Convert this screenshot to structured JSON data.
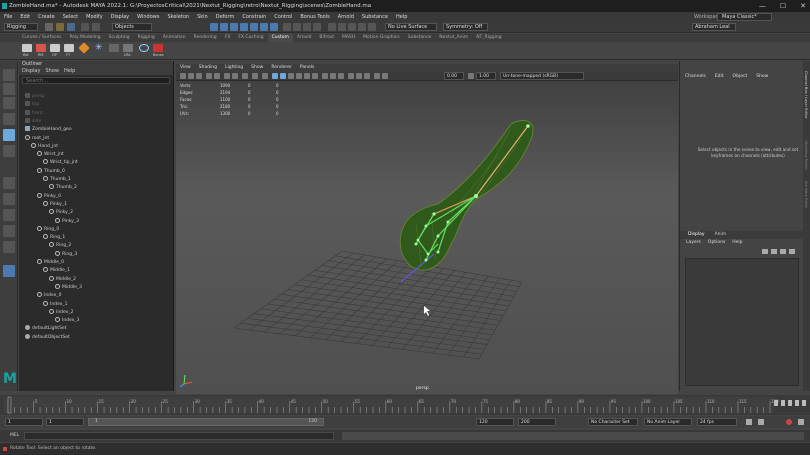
{
  "window": {
    "title": "ZombieHand.ma* - Autodesk MAYA 2022.1: G:\\ProyectosCritical\\2021\\Nextut_Rigging\\retro\\Nextut_Rigging\\scenes\\ZombieHand.ma",
    "minimize": "—",
    "maximize": "☐",
    "close": "✕"
  },
  "menubar": [
    "File",
    "Edit",
    "Create",
    "Select",
    "Modify",
    "Display",
    "Windows",
    "Skeleton",
    "Skin",
    "Deform",
    "Constrain",
    "Control",
    "Bonus Tools",
    "Arnold",
    "Substance",
    "Help"
  ],
  "workspace": {
    "label": "Workspace :",
    "value": "Maya Classic*"
  },
  "statusline": {
    "mode": "Rigging",
    "objects": "Objects",
    "live_surface": "No Live Surface",
    "symmetry": "Symmetry: Off",
    "user": "Abraham Leal"
  },
  "shelf_tabs": [
    "Curves / Surfaces",
    "Poly Modeling",
    "Sculpting",
    "Rigging",
    "Animation",
    "Rendering",
    "FX",
    "FX Caching",
    "Custom",
    "Arnold",
    "Bifrost",
    "MASH",
    "Motion Graphics",
    "Substance",
    "Nextut_Anim",
    "NT_Rigging"
  ],
  "shelf_tabs_active": "Custom",
  "shelf_items": [
    "Rot",
    "RM",
    "OP",
    "FT",
    "",
    "",
    "",
    "LRA",
    "",
    "Bones"
  ],
  "outliner": {
    "title": "Outliner",
    "menus": [
      "Display",
      "Show",
      "Help"
    ],
    "search_placeholder": "Search...",
    "items": [
      {
        "label": "persp",
        "depth": 0,
        "kind": "cam",
        "dim": true
      },
      {
        "label": "top",
        "depth": 0,
        "kind": "cam",
        "dim": true
      },
      {
        "label": "front",
        "depth": 0,
        "kind": "cam",
        "dim": true
      },
      {
        "label": "side",
        "depth": 0,
        "kind": "cam",
        "dim": true
      },
      {
        "label": "ZombieHand_geo",
        "depth": 0,
        "kind": "grp"
      },
      {
        "label": "root_jnt",
        "depth": 0,
        "kind": "jnt"
      },
      {
        "label": "Hand_jnt",
        "depth": 1,
        "kind": "jnt"
      },
      {
        "label": "Wrist_jnt",
        "depth": 2,
        "kind": "jnt"
      },
      {
        "label": "Wrist_tip_jnt",
        "depth": 3,
        "kind": "jnt"
      },
      {
        "label": "Thumb_0",
        "depth": 2,
        "kind": "jnt"
      },
      {
        "label": "Thumb_1",
        "depth": 3,
        "kind": "jnt"
      },
      {
        "label": "Thumb_2",
        "depth": 4,
        "kind": "jnt"
      },
      {
        "label": "Pinky_0",
        "depth": 2,
        "kind": "jnt"
      },
      {
        "label": "Pinky_1",
        "depth": 3,
        "kind": "jnt"
      },
      {
        "label": "Pinky_2",
        "depth": 4,
        "kind": "jnt"
      },
      {
        "label": "Pinky_3",
        "depth": 5,
        "kind": "jnt"
      },
      {
        "label": "Ring_0",
        "depth": 2,
        "kind": "jnt"
      },
      {
        "label": "Ring_1",
        "depth": 3,
        "kind": "jnt"
      },
      {
        "label": "Ring_2",
        "depth": 4,
        "kind": "jnt"
      },
      {
        "label": "Ring_3",
        "depth": 5,
        "kind": "jnt"
      },
      {
        "label": "Middle_0",
        "depth": 2,
        "kind": "jnt"
      },
      {
        "label": "Middle_1",
        "depth": 3,
        "kind": "jnt"
      },
      {
        "label": "Middle_2",
        "depth": 4,
        "kind": "jnt"
      },
      {
        "label": "Middle_3",
        "depth": 5,
        "kind": "jnt"
      },
      {
        "label": "Index_0",
        "depth": 2,
        "kind": "jnt"
      },
      {
        "label": "Index_1",
        "depth": 3,
        "kind": "jnt"
      },
      {
        "label": "Index_2",
        "depth": 4,
        "kind": "jnt"
      },
      {
        "label": "Index_3",
        "depth": 5,
        "kind": "jnt"
      },
      {
        "label": "defaultLightSet",
        "depth": 0,
        "kind": "set"
      },
      {
        "label": "defaultObjectSet",
        "depth": 0,
        "kind": "set"
      }
    ]
  },
  "viewport": {
    "menus": [
      "View",
      "Shading",
      "Lighting",
      "Show",
      "Renderer",
      "Panels"
    ],
    "exposure": "0.00",
    "gamma": "1.00",
    "colorspace": "Un-tone-mapped (sRGB)",
    "camera_label": "persp",
    "hud": [
      {
        "label": "Verts:",
        "v1": "1090",
        "v2": "0",
        "v3": "0"
      },
      {
        "label": "Edges:",
        "v1": "2194",
        "v2": "0",
        "v3": "0"
      },
      {
        "label": "Faces:",
        "v1": "1100",
        "v2": "0",
        "v3": "0"
      },
      {
        "label": "Tris:",
        "v1": "2180",
        "v2": "0",
        "v3": "0"
      },
      {
        "label": "UVs:",
        "v1": "1300",
        "v2": "0",
        "v3": "0"
      }
    ]
  },
  "channelbox": {
    "tabs": [
      "Channels",
      "Edit",
      "Object",
      "Show"
    ],
    "empty_message": "Select objects in the scene to view, edit and set keyframes on channels (attributes)",
    "layer_tabs": [
      "Display",
      "Anim"
    ],
    "layer_menus": [
      "Layers",
      "Options",
      "Help"
    ]
  },
  "side_tabs": [
    "Channel Box / Layer Editor",
    "Modeling Toolkit",
    "Attribute Editor"
  ],
  "timeline": {
    "ticks": [
      "1",
      "5",
      "10",
      "15",
      "20",
      "25",
      "30",
      "35",
      "40",
      "45",
      "50",
      "55",
      "60",
      "65",
      "70",
      "75",
      "80",
      "85",
      "90",
      "95",
      "100",
      "105",
      "110",
      "115",
      "120"
    ],
    "current_frame": "1"
  },
  "range": {
    "start": "1",
    "playback_start": "1",
    "playback_slider_value": "1",
    "playback_end_inner": "120",
    "end": "120",
    "anim_end": "200",
    "character_set": "No Character Set",
    "anim_layer": "No Anim Layer",
    "fps": "24 fps"
  },
  "mel": {
    "label": "MEL"
  },
  "helpline": "Rotate Tool: Select an object to rotate.",
  "colors": {
    "joint": "#5fe05f",
    "bone": "#e0a060",
    "mesh": "#2f5a1c",
    "wire": "#6a8a30",
    "accent": "#6fa8dc"
  }
}
